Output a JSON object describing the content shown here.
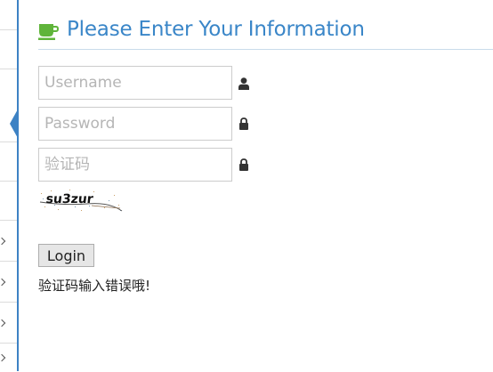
{
  "header": {
    "title": "Please Enter Your Information",
    "icon": "coffee-cup-icon",
    "accent_color": "#3a86c8",
    "icon_color": "#5fb43a"
  },
  "form": {
    "username": {
      "placeholder": "Username",
      "value": "",
      "icon": "user-icon"
    },
    "password": {
      "placeholder": "Password",
      "value": "",
      "icon": "lock-icon"
    },
    "captcha_input": {
      "placeholder": "验证码",
      "value": "",
      "icon": "lock-icon"
    },
    "captcha_image_text": "su3zur",
    "login_label": "Login",
    "error_message": "验证码输入错误哦!"
  },
  "sidebar": {
    "accent_color": "#3d82c4",
    "items": [
      {
        "icon": ""
      },
      {
        "icon": ""
      },
      {
        "icon": ""
      },
      {
        "icon": ""
      },
      {
        "icon": ""
      },
      {
        "icon": "chevron-right-icon"
      },
      {
        "icon": "chevron-right-icon"
      },
      {
        "icon": "chevron-right-icon"
      },
      {
        "icon": "chevron-right-icon"
      }
    ]
  }
}
